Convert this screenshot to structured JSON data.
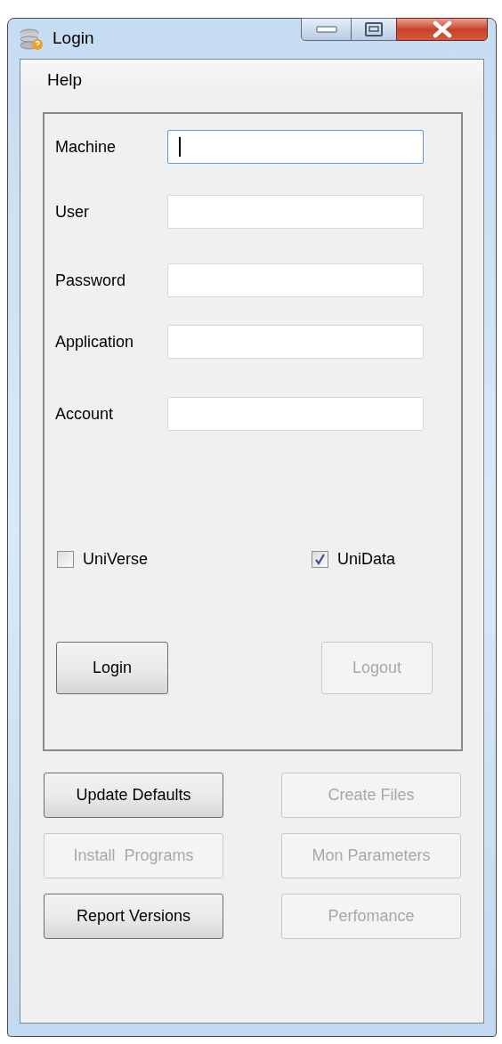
{
  "window": {
    "title": "Login"
  },
  "menu": [
    "Help"
  ],
  "fields": [
    {
      "label": "Machine",
      "focused": true
    },
    {
      "label": "User",
      "focused": false
    },
    {
      "label": "Password",
      "focused": false
    },
    {
      "label": "Application",
      "focused": false
    },
    {
      "label": "Account",
      "focused": false
    }
  ],
  "options": [
    {
      "label": "UniVerse",
      "checked": false
    },
    {
      "label": "UniData",
      "checked": true
    }
  ],
  "session_buttons": [
    {
      "label": "Login",
      "disabled": false
    },
    {
      "label": "Logout",
      "disabled": true
    }
  ],
  "action_buttons": [
    {
      "label": "Update Defaults",
      "disabled": false
    },
    {
      "label": "Create Files",
      "disabled": true
    },
    {
      "label": "Install  Programs",
      "disabled": true
    },
    {
      "label": "Mon Parameters",
      "disabled": true
    },
    {
      "label": "Report Versions",
      "disabled": false
    },
    {
      "label": "Perfomance",
      "disabled": true
    }
  ]
}
